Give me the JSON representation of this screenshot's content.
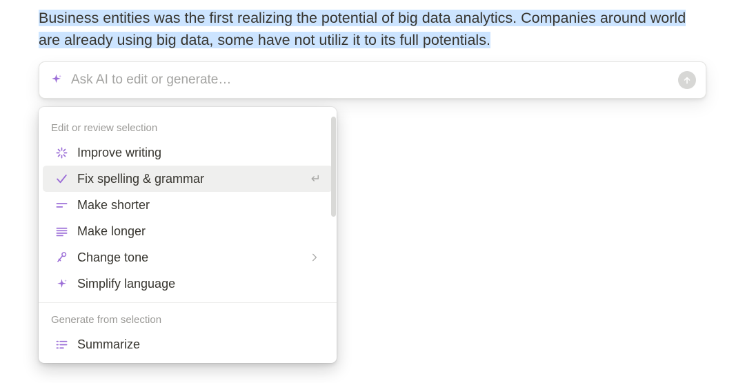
{
  "selectedText": "Business entities was the first realizing the potential of big data analytics. Companies around world are already using big data, some have not utiliz it to its full potentials.",
  "prompt": {
    "placeholder": "Ask AI to edit or generate…",
    "value": ""
  },
  "sections": [
    {
      "header": "Edit or review selection",
      "items": [
        {
          "icon": "burst",
          "label": "Improve writing",
          "hovered": false
        },
        {
          "icon": "check",
          "label": "Fix spelling & grammar",
          "hovered": true,
          "showEnter": true
        },
        {
          "icon": "short-lines",
          "label": "Make shorter",
          "hovered": false
        },
        {
          "icon": "long-lines",
          "label": "Make longer",
          "hovered": false
        },
        {
          "icon": "mic",
          "label": "Change tone",
          "hovered": false,
          "hasSubmenu": true
        },
        {
          "icon": "sparkle",
          "label": "Simplify language",
          "hovered": false
        }
      ]
    },
    {
      "header": "Generate from selection",
      "items": [
        {
          "icon": "summarize",
          "label": "Summarize",
          "hovered": false
        }
      ]
    }
  ],
  "colors": {
    "accent": "#9b6dd7",
    "selection": "#cce4ff"
  }
}
